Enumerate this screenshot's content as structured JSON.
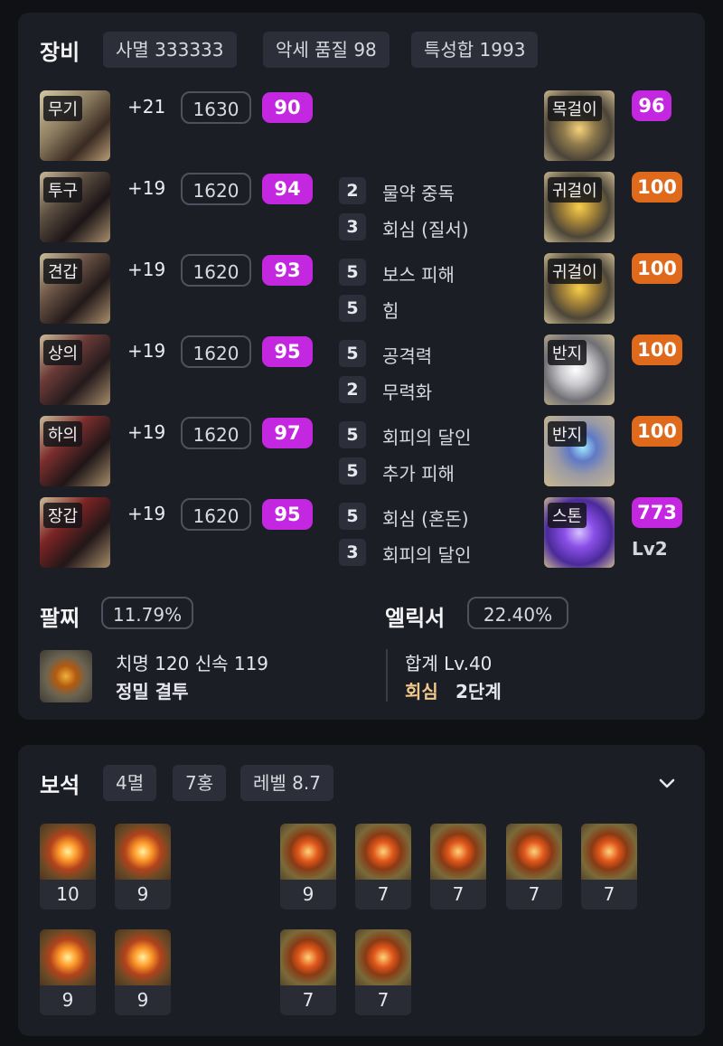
{
  "equipment": {
    "title": "장비",
    "chips": [
      "사멸 333333",
      "악세 품질 98",
      "특성합 1993"
    ],
    "gear": [
      {
        "label": "무기",
        "enhance": "+21",
        "item_level": "1630",
        "quality": "90",
        "icon": "weapon-icon"
      },
      {
        "label": "투구",
        "enhance": "+19",
        "item_level": "1620",
        "quality": "94",
        "icon": "helmet-icon"
      },
      {
        "label": "견갑",
        "enhance": "+19",
        "item_level": "1620",
        "quality": "93",
        "icon": "shoulder-icon"
      },
      {
        "label": "상의",
        "enhance": "+19",
        "item_level": "1620",
        "quality": "95",
        "icon": "chest-icon"
      },
      {
        "label": "하의",
        "enhance": "+19",
        "item_level": "1620",
        "quality": "97",
        "icon": "pants-icon"
      },
      {
        "label": "장갑",
        "enhance": "+19",
        "item_level": "1620",
        "quality": "95",
        "icon": "gloves-icon"
      }
    ],
    "engravings": [
      {
        "level": "2",
        "name": "물약 중독"
      },
      {
        "level": "3",
        "name": "회심 (질서)"
      },
      {
        "level": "5",
        "name": "보스 피해"
      },
      {
        "level": "5",
        "name": "힘"
      },
      {
        "level": "5",
        "name": "공격력"
      },
      {
        "level": "2",
        "name": "무력화"
      },
      {
        "level": "5",
        "name": "회피의 달인"
      },
      {
        "level": "5",
        "name": "추가 피해"
      },
      {
        "level": "5",
        "name": "회심 (혼돈)"
      },
      {
        "level": "3",
        "name": "회피의 달인"
      }
    ],
    "accessories": [
      {
        "label": "목걸이",
        "quality": "96",
        "color": "#c327e0",
        "icon": "necklace-icon"
      },
      {
        "label": "귀걸이",
        "quality": "100",
        "color": "#e06a1c",
        "icon": "earring-icon"
      },
      {
        "label": "귀걸이",
        "quality": "100",
        "color": "#e06a1c",
        "icon": "earring-icon"
      },
      {
        "label": "반지",
        "quality": "100",
        "color": "#e06a1c",
        "icon": "ring-icon"
      },
      {
        "label": "반지",
        "quality": "100",
        "color": "#e06a1c",
        "icon": "ring-icon"
      },
      {
        "label": "스톤",
        "quality": "773",
        "color": "#c327e0",
        "icon": "stone-icon",
        "sub": "Lv2"
      }
    ],
    "bracelet": {
      "title": "팔찌",
      "percent": "11.79%",
      "stats": "치명 120  신속 119",
      "effects": "정밀  결투",
      "icon": "bracelet-icon"
    },
    "elixir": {
      "title": "엘릭서",
      "percent": "22.40%",
      "total": "합계 Lv.40",
      "effect_name": "회심",
      "effect_stage": "2단계"
    }
  },
  "gems": {
    "title": "보석",
    "chips": [
      "4멸",
      "7홍",
      "레벨 8.7"
    ],
    "expand_icon": "chevron-down-icon",
    "levels": [
      "10",
      "9",
      "9",
      "7",
      "7",
      "7",
      "7",
      "9",
      "9",
      "7",
      "7"
    ],
    "types": [
      "멸",
      "멸",
      "홍",
      "홍",
      "홍",
      "홍",
      "홍",
      "멸",
      "멸",
      "홍",
      "홍"
    ]
  },
  "colors": {
    "purple": "#c327e0",
    "orange": "#e06a1c",
    "panel": "#1c1e26",
    "background": "#101114"
  }
}
